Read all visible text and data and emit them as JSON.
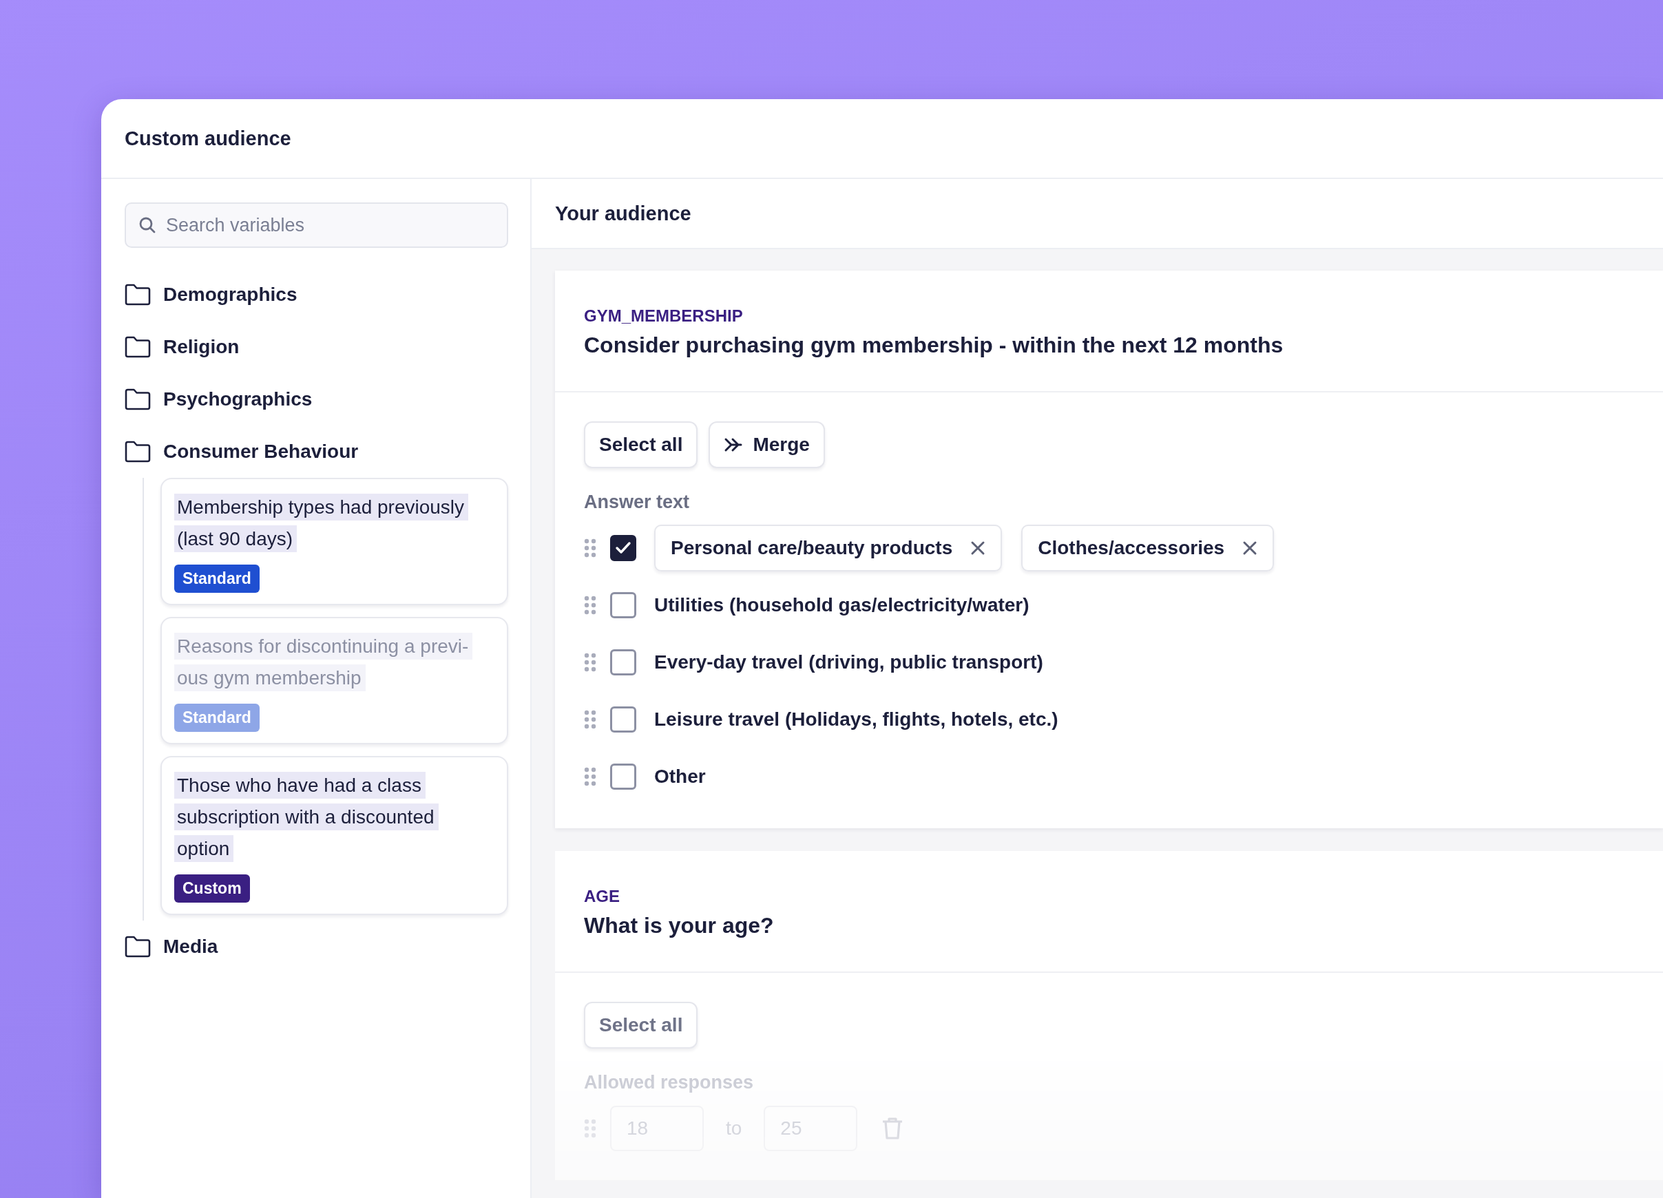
{
  "window": {
    "title": "Custom audience"
  },
  "sidebar": {
    "search": {
      "placeholder": "Search variables"
    },
    "folders": [
      {
        "label": "Demographics"
      },
      {
        "label": "Religion"
      },
      {
        "label": "Psychographics"
      },
      {
        "label": "Consumer Behaviour",
        "children": [
          {
            "label": "Membership types had previously (last 90 days)",
            "tag": "Standard",
            "kind": "standard",
            "disabled": false
          },
          {
            "label": "Reasons for discontinuing a previ-ous gym membership",
            "tag": "Standard",
            "kind": "standard",
            "disabled": true
          },
          {
            "label": "Those who have had a class subscription with a discounted option",
            "tag": "Custom",
            "kind": "custom",
            "disabled": false
          }
        ]
      },
      {
        "label": "Media"
      }
    ]
  },
  "main": {
    "title": "Your audience",
    "questions": [
      {
        "code": "GYM_MEMBERSHIP",
        "question": "Consider purchasing gym membership - within the next 12 months",
        "buttons": [
          {
            "label": "Select all",
            "kind": "plain"
          },
          {
            "label": "Merge",
            "kind": "merge"
          }
        ],
        "section_label": "Answer text",
        "faded": false,
        "answers": [
          {
            "kind": "merged",
            "checked": true,
            "chips": [
              "Personal care/beauty products",
              "Clothes/accessories"
            ]
          },
          {
            "kind": "option",
            "checked": false,
            "label": "Utilities (household gas/electricity/water)"
          },
          {
            "kind": "option",
            "checked": false,
            "label": "Every-day travel (driving, public transport)"
          },
          {
            "kind": "option",
            "checked": false,
            "label": "Leisure travel (Holidays, flights, hotels, etc.)"
          },
          {
            "kind": "option",
            "checked": false,
            "label": "Other"
          }
        ]
      },
      {
        "code": "AGE",
        "question": "What is your age?",
        "buttons": [
          {
            "label": "Select all",
            "kind": "plain"
          }
        ],
        "section_label": "Allowed responses",
        "faded": true,
        "answers": [
          {
            "kind": "range",
            "from": "18",
            "separator": "to",
            "to": "25"
          }
        ]
      }
    ]
  }
}
